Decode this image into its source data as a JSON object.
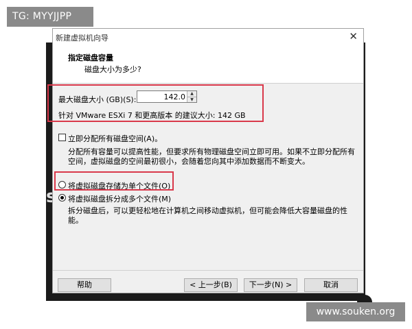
{
  "watermarks": {
    "top_left": "TG: MYYJJPP",
    "bottom_right": "www.souken.org"
  },
  "background_peek": "s",
  "dialog": {
    "title": "新建虚拟机向导",
    "close_glyph": "✕",
    "header": {
      "title": "指定磁盘容量",
      "subtitle": "磁盘大小为多少?"
    },
    "disk_size": {
      "label": "最大磁盘大小 (GB)(S):",
      "value": "142.0",
      "recommendation": "针对 VMware ESXi 7 和更高版本 的建议大小: 142 GB"
    },
    "allocate": {
      "label": "立即分配所有磁盘空间(A)。",
      "checked": false,
      "description": "分配所有容量可以提高性能，但要求所有物理磁盘空间立即可用。如果不立即分配所有空间，虚拟磁盘的空间最初很小，会随着您向其中添加数据而不断变大。"
    },
    "storage_options": [
      {
        "label": "将虚拟磁盘存储为单个文件(O)",
        "selected": false
      },
      {
        "label": "将虚拟磁盘拆分成多个文件(M)",
        "selected": true
      }
    ],
    "split_description": "拆分磁盘后，可以更轻松地在计算机之间移动虚拟机，但可能会降低大容量磁盘的性能。",
    "buttons": {
      "help": "帮助",
      "back": "< 上一步(B)",
      "next": "下一步(N) >",
      "cancel": "取消"
    }
  }
}
